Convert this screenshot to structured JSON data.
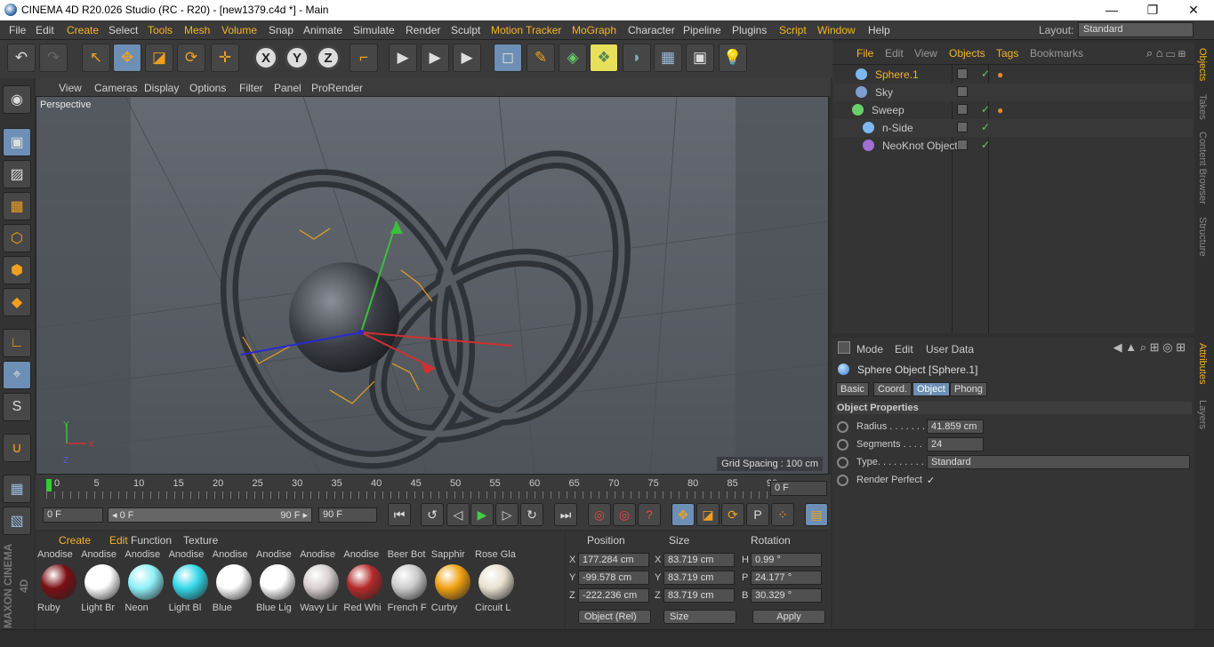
{
  "window": {
    "title": "CINEMA 4D R20.026 Studio (RC - R20) - [new1379.c4d *] - Main",
    "minimize": "—",
    "maximize": "❐",
    "close": "✕"
  },
  "menubar": {
    "items": [
      "File",
      "Edit",
      "Create",
      "Select",
      "Tools",
      "Mesh",
      "Volume",
      "Snap",
      "Animate",
      "Simulate",
      "Render",
      "Sculpt",
      "Motion Tracker",
      "MoGraph",
      "Character",
      "Pipeline",
      "Plugins",
      "Script",
      "Window",
      "Help"
    ],
    "highlighted": [
      "Create",
      "Tools",
      "Mesh",
      "Volume",
      "Motion Tracker",
      "MoGraph",
      "Script",
      "Window"
    ],
    "layout_label": "Layout:",
    "layout_value": "Standard"
  },
  "toolbar": {
    "undo": "↶",
    "redo": "↷",
    "select": "↖",
    "move": "✥",
    "scale": "◪",
    "rotate": "⟳",
    "live": "✛",
    "x": "X",
    "y": "Y",
    "z": "Z",
    "coord": "⌐",
    "render_view": "▶",
    "render_pv": "▶",
    "render_settings": "▶",
    "cube": "◻",
    "pen": "✎",
    "subdiv": "◈",
    "array": "❖",
    "deformer": "◗",
    "floor": "▦",
    "camera": "▣",
    "light": "💡"
  },
  "viewport_menu": [
    "View",
    "Cameras",
    "Display",
    "Options",
    "Filter",
    "Panel",
    "ProRender"
  ],
  "viewport": {
    "label": "Perspective",
    "grid_spacing": "Grid Spacing : 100 cm"
  },
  "timeline": {
    "ticks": [
      "0",
      "5",
      "10",
      "15",
      "20",
      "25",
      "30",
      "35",
      "40",
      "45",
      "50",
      "55",
      "60",
      "65",
      "70",
      "75",
      "80",
      "85",
      "90"
    ],
    "current": "0 F"
  },
  "transport": {
    "start": "0 F",
    "range_start": "◂ 0 F",
    "range_end": "90 F ▸",
    "end": "90 F"
  },
  "materials": {
    "menu": [
      "Create",
      "Edit",
      "Function",
      "Texture"
    ],
    "items": [
      {
        "head": "Anodise",
        "name": "Ruby",
        "color": "#7a0f14"
      },
      {
        "head": "Anodise",
        "name": "Light Br",
        "color": "#ffffff"
      },
      {
        "head": "Anodise",
        "name": "Neon",
        "color": "#8ef0f8"
      },
      {
        "head": "Anodise",
        "name": "Light Bl",
        "color": "#33d8ea"
      },
      {
        "head": "Anodise",
        "name": "Blue",
        "color": "#ffffff"
      },
      {
        "head": "Anodise",
        "name": "Blue Lig",
        "color": "#ffffff"
      },
      {
        "head": "Anodise",
        "name": "Wavy Lir",
        "color": "#d8d0d0"
      },
      {
        "head": "Anodise",
        "name": "Red Whi",
        "color": "#b52a2a"
      },
      {
        "head": "Beer Bot",
        "name": "French F",
        "color": "#cccccc"
      },
      {
        "head": "Sapphir",
        "name": "Curby",
        "color": "#f0a010"
      },
      {
        "head": "Rose Gla",
        "name": "Circuit L",
        "color": "#e8e0d0"
      }
    ]
  },
  "coords": {
    "headers": [
      "Position",
      "Size",
      "Rotation"
    ],
    "rows": [
      {
        "a": "X",
        "pos": "177.284 cm",
        "b": "X",
        "size": "83.719 cm",
        "c": "H",
        "rot": "0.99 °"
      },
      {
        "a": "Y",
        "pos": "-99.578 cm",
        "b": "Y",
        "size": "83.719 cm",
        "c": "P",
        "rot": "24.177 °"
      },
      {
        "a": "Z",
        "pos": "-222.236 cm",
        "b": "Z",
        "size": "83.719 cm",
        "c": "B",
        "rot": "30.329 °"
      }
    ],
    "mode": "Object (Rel)",
    "size_mode": "Size",
    "apply": "Apply"
  },
  "objects": {
    "menu": [
      "File",
      "Edit",
      "View",
      "Objects",
      "Tags",
      "Bookmarks"
    ],
    "highlighted": [
      "File",
      "Objects",
      "Tags"
    ],
    "items": [
      {
        "name": "Sphere.1",
        "selected": true,
        "tag": true,
        "check": "✓",
        "color": "#7fb8f0"
      },
      {
        "name": "Sky",
        "selected": false,
        "tag": false,
        "check": "",
        "color": "#7f9fd0"
      },
      {
        "name": "Sweep",
        "selected": false,
        "tag": true,
        "check": "✓",
        "color": "#6ad06a"
      },
      {
        "name": "n-Side",
        "selected": false,
        "tag": false,
        "check": "✓",
        "color": "#7fb8f0"
      },
      {
        "name": "NeoKnot Object",
        "selected": false,
        "tag": false,
        "check": "✓",
        "color": "#a070d0"
      }
    ]
  },
  "attributes": {
    "menu": [
      "Mode",
      "Edit",
      "User Data"
    ],
    "title": "Sphere Object [Sphere.1]",
    "tabs": [
      "Basic",
      "Coord.",
      "Object",
      "Phong"
    ],
    "active_tab": "Object",
    "section": "Object Properties",
    "props": [
      {
        "label": "Radius . . . . . . .",
        "value": "41.859 cm"
      },
      {
        "label": "Segments . . . .",
        "value": "24"
      },
      {
        "label": "Type. . . . . . . . .",
        "value": "Standard"
      },
      {
        "label": "Render Perfect",
        "value": "✓"
      }
    ]
  },
  "side_tabs_top": [
    "Objects",
    "Takes",
    "Content Browser",
    "Structure"
  ],
  "side_tabs_bottom": [
    "Attributes",
    "Layers"
  ],
  "brand": "MAXON CINEMA 4D"
}
